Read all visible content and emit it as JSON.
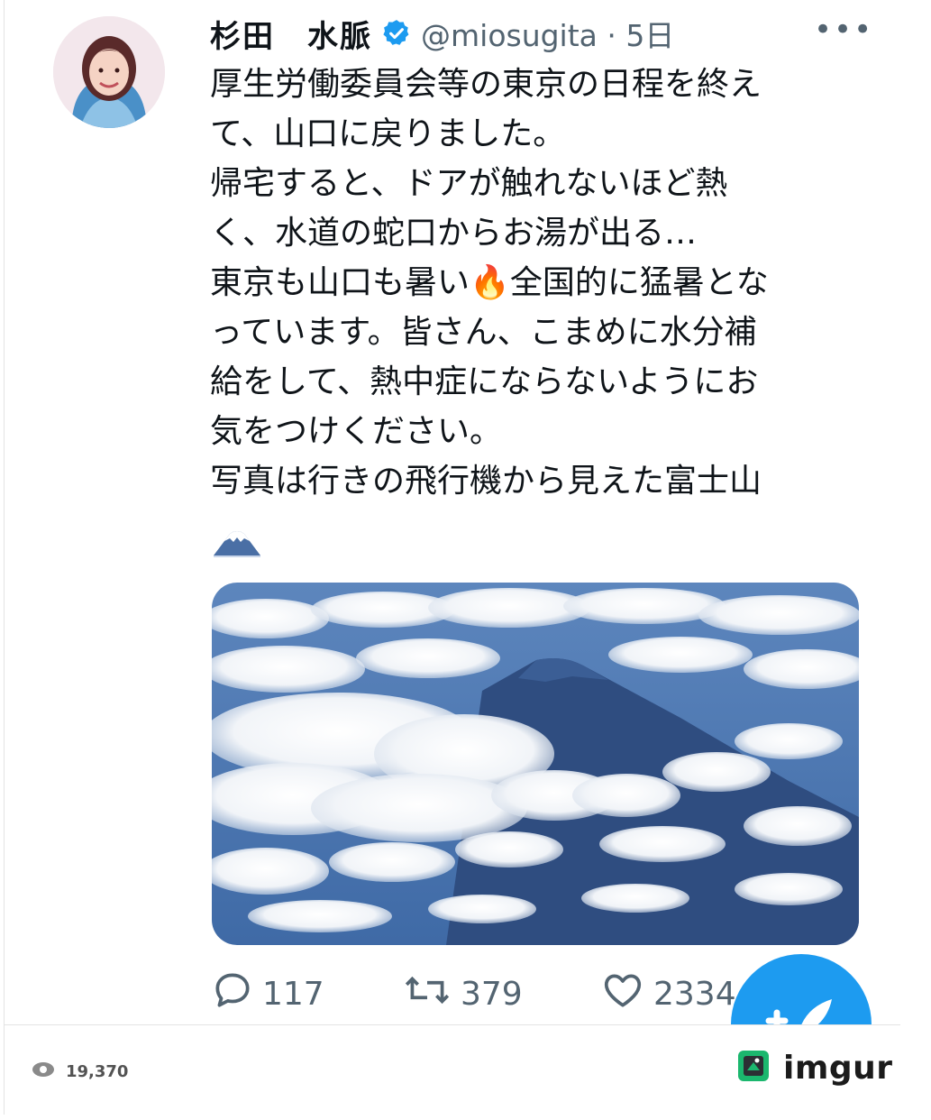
{
  "tweet": {
    "author_name": "杉田　水脈",
    "handle_and_time": "@miosugita · 5日",
    "more_label": "•••",
    "text_lines": [
      "厚生労働委員会等の東京の日程を終え",
      "て、山口に戻りました。",
      "帰宅すると、ドアが触れないほど熱",
      "く、水道の蛇口からお湯が出る…",
      "東京も山口も暑い🔥全国的に猛暑とな",
      "っています。皆さん、こまめに水分補",
      "給をして、熱中症にならないようにお",
      "気をつけください。",
      "写真は行きの飛行機から見えた富士山"
    ],
    "emoji_icon": "mount-fuji-icon",
    "photo_alt": "Mount Fuji above clouds",
    "actions": {
      "reply_count": "117",
      "retweet_count": "379",
      "like_count": "2334"
    }
  },
  "footer": {
    "views": "19,370",
    "brand": "imgur"
  },
  "colors": {
    "accent": "#1d9bf0",
    "muted": "#536471",
    "imgur_green": "#1bb76e"
  }
}
